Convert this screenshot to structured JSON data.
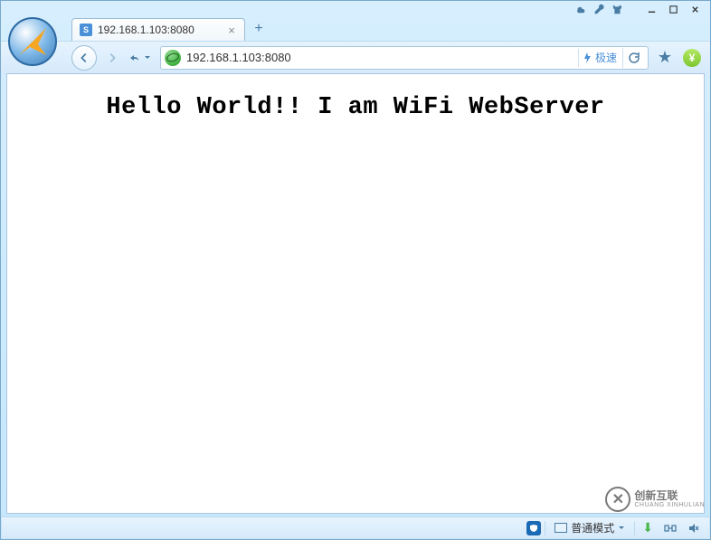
{
  "tab": {
    "title": "192.168.1.103:8080",
    "favicon_letter": "S"
  },
  "address": {
    "url": "192.168.1.103:8080",
    "speed_label": "极速"
  },
  "page": {
    "heading": "Hello World!! I am WiFi WebServer"
  },
  "status": {
    "mode_label": "普通模式",
    "money_symbol": "¥"
  },
  "watermark": {
    "main": "创新互联",
    "sub": "CHUANG XINHULIAN"
  }
}
